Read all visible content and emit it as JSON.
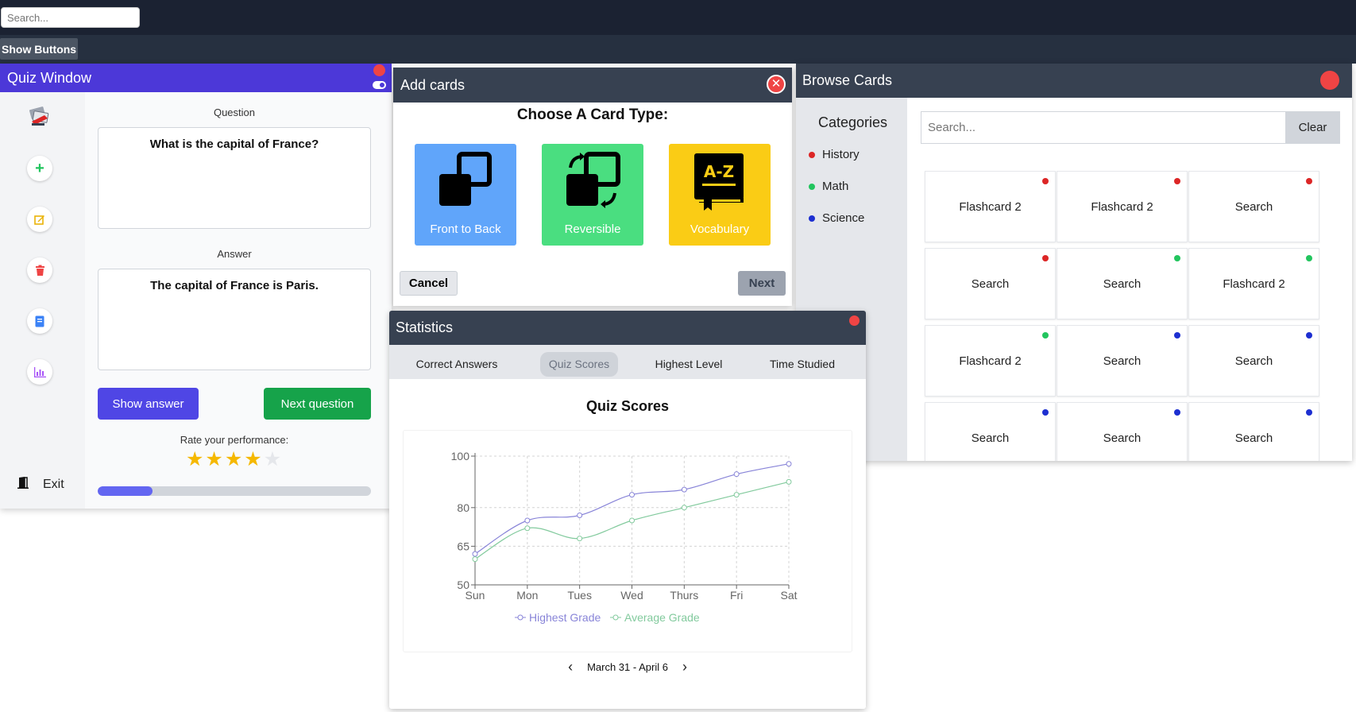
{
  "top": {
    "search_placeholder": "Search...",
    "show_buttons_label": "Show Buttons"
  },
  "quiz": {
    "title": "Quiz Window",
    "question_label": "Question",
    "question_text": "What is the capital of France?",
    "answer_label": "Answer",
    "answer_text": "The capital of France is Paris.",
    "show_answer_label": "Show answer",
    "next_question_label": "Next question",
    "rate_label": "Rate your performance:",
    "rating": 4,
    "rating_max": 5,
    "progress_fraction": 0.2,
    "exit_label": "Exit",
    "side_icons": [
      "cards-logo-icon",
      "plus-icon",
      "edit-icon",
      "trash-icon",
      "book-icon",
      "chart-icon"
    ],
    "colors": {
      "header": "#4c38d8",
      "show": "#4f46e5",
      "next": "#16a34a",
      "star": "#f5b800"
    }
  },
  "add_cards": {
    "title": "Add cards",
    "heading": "Choose A Card Type:",
    "types": [
      {
        "label": "Front to Back",
        "color": "#60a5fa",
        "icon": "front-back-icon"
      },
      {
        "label": "Reversible",
        "color": "#4ade80",
        "icon": "reversible-icon"
      },
      {
        "label": "Vocabulary",
        "color": "#facc15",
        "icon": "vocabulary-book-icon",
        "icon_text": "A-Z"
      }
    ],
    "cancel_label": "Cancel",
    "next_label": "Next"
  },
  "browse": {
    "title": "Browse Cards",
    "categories_title": "Categories",
    "categories": [
      {
        "label": "History",
        "color": "#dc2626"
      },
      {
        "label": "Math",
        "color": "#22c55e"
      },
      {
        "label": "Science",
        "color": "#1d2fd1"
      }
    ],
    "search_placeholder": "Search...",
    "clear_label": "Clear",
    "cards": [
      {
        "label": "Flashcard 2",
        "color": "#dc2626"
      },
      {
        "label": "Flashcard 2",
        "color": "#dc2626"
      },
      {
        "label": "Search",
        "color": "#dc2626"
      },
      {
        "label": "Search",
        "color": "#dc2626"
      },
      {
        "label": "Search",
        "color": "#22c55e"
      },
      {
        "label": "Flashcard 2",
        "color": "#22c55e"
      },
      {
        "label": "Flashcard 2",
        "color": "#22c55e"
      },
      {
        "label": "Search",
        "color": "#1d2fd1"
      },
      {
        "label": "Search",
        "color": "#1d2fd1"
      },
      {
        "label": "Search",
        "color": "#1d2fd1"
      },
      {
        "label": "Search",
        "color": "#1d2fd1"
      },
      {
        "label": "Search",
        "color": "#1d2fd1"
      }
    ]
  },
  "stats": {
    "title": "Statistics",
    "tabs": [
      "Correct Answers",
      "Quiz Scores",
      "Highest Level",
      "Time Studied"
    ],
    "active_tab": 1,
    "date_range": "March 31 - April 6"
  },
  "chart_data": {
    "type": "line",
    "title": "Quiz Scores",
    "categories": [
      "Sun",
      "Mon",
      "Tues",
      "Wed",
      "Thurs",
      "Fri",
      "Sat"
    ],
    "series": [
      {
        "name": "Highest Grade",
        "color": "#8884d8",
        "values": [
          62,
          75,
          77,
          85,
          87,
          93,
          97
        ]
      },
      {
        "name": "Average Grade",
        "color": "#82ca9d",
        "values": [
          60,
          72,
          68,
          75,
          80,
          85,
          90
        ]
      }
    ],
    "yticks": [
      50,
      65,
      80,
      100
    ],
    "ylim": [
      50,
      100
    ],
    "grid": true,
    "legend": "bottom"
  }
}
